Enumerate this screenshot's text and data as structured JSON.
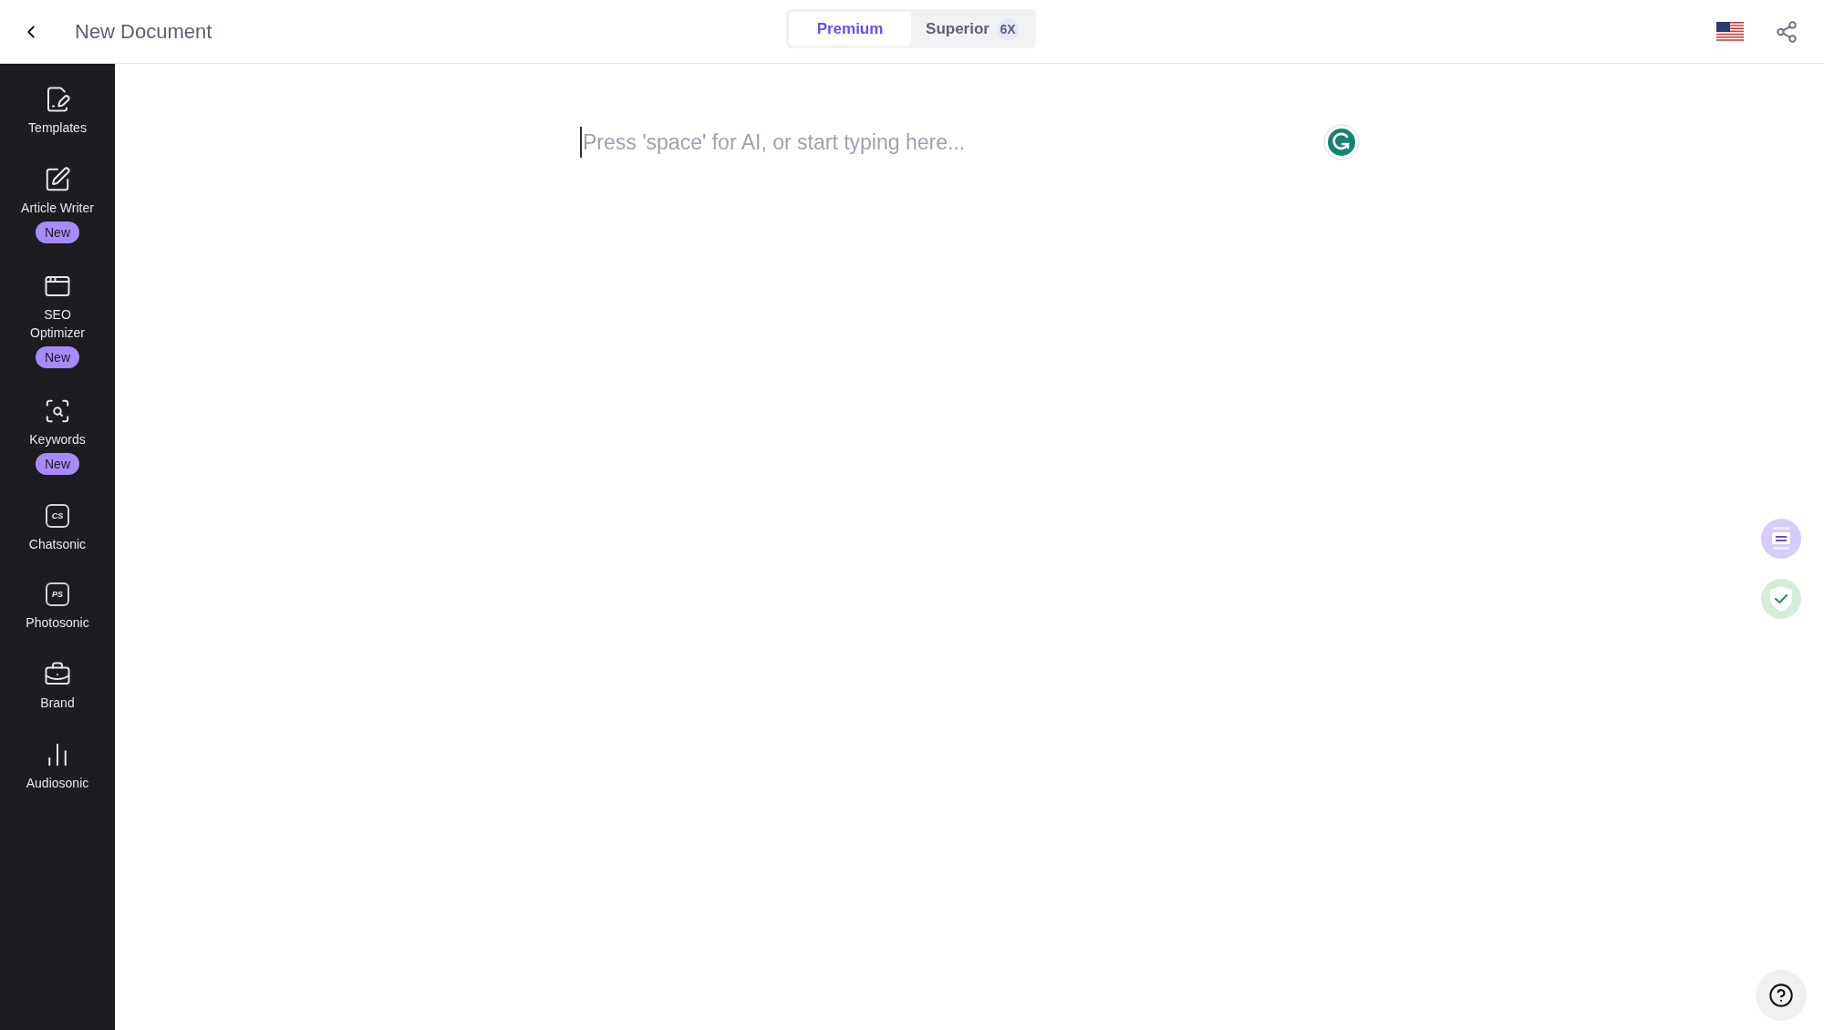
{
  "header": {
    "title": "New Document"
  },
  "plan_tabs": [
    {
      "label": "Premium",
      "selected": true
    },
    {
      "label": "Superior",
      "badge": "6X",
      "selected": false
    }
  ],
  "sidebar": {
    "items": [
      {
        "label": "Templates"
      },
      {
        "label": "Article Writer",
        "badge": "New"
      },
      {
        "label": "SEO Optimizer",
        "badge": "New"
      },
      {
        "label": "Keywords",
        "badge": "New"
      },
      {
        "label": "Chatsonic",
        "icon_text": "CS"
      },
      {
        "label": "Photosonic",
        "icon_text": "PS"
      },
      {
        "label": "Brand"
      },
      {
        "label": "Audiosonic"
      }
    ]
  },
  "editor": {
    "placeholder": "Press 'space' for AI, or start typing here..."
  }
}
